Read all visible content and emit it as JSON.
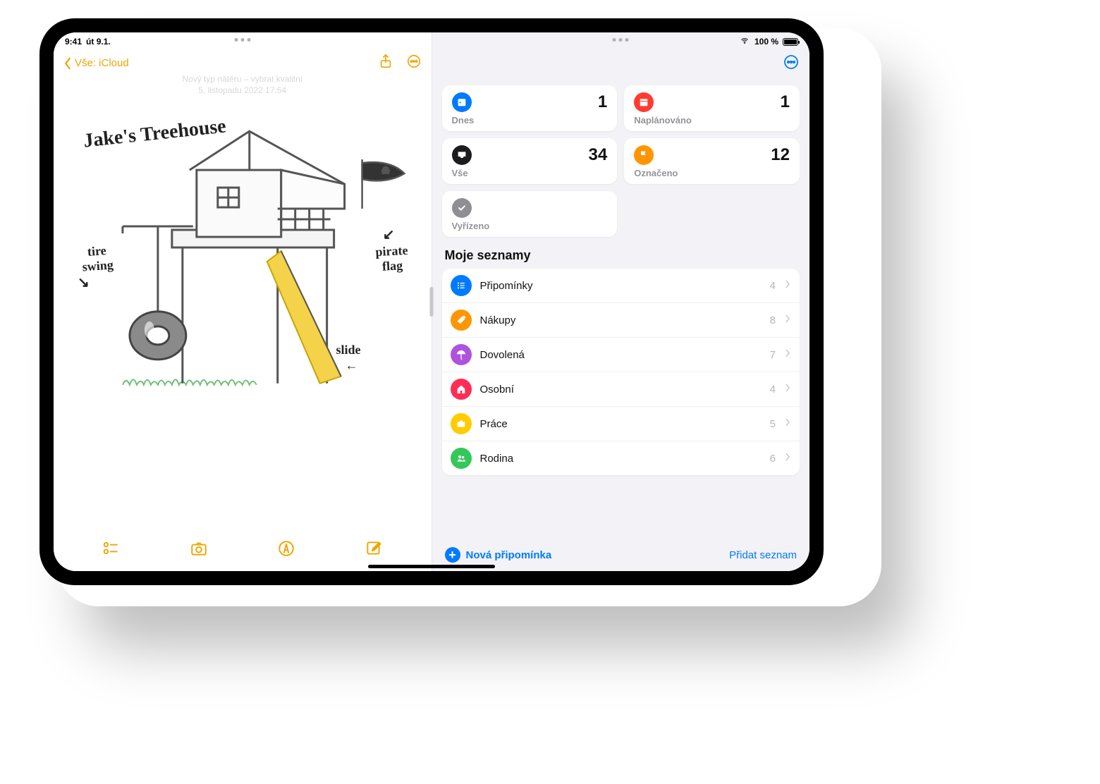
{
  "status": {
    "time": "9:41",
    "date": "út 9.1.",
    "battery_text": "100 %"
  },
  "notes": {
    "back_label": "Vše: iCloud",
    "meta_line1": "Nový typ nátěru – vybrat kvalitní",
    "meta_line2": "5. listopadu 2022 17:54",
    "sketch_title": "Jake's Treehouse",
    "ann_tire_swing": "tire swing",
    "ann_pirate_flag": "pirate flag",
    "ann_slide": "slide"
  },
  "reminders": {
    "cards": {
      "today": {
        "label": "Dnes",
        "count": "1",
        "color": "#007aff"
      },
      "scheduled": {
        "label": "Naplánováno",
        "count": "1",
        "color": "#ff3b30"
      },
      "all": {
        "label": "Vše",
        "count": "34",
        "color": "#1c1c1e"
      },
      "flagged": {
        "label": "Označeno",
        "count": "12",
        "color": "#ff9500"
      },
      "completed": {
        "label": "Vyřízeno",
        "count": "",
        "color": "#8e8e93"
      }
    },
    "lists_title": "Moje seznamy",
    "lists": [
      {
        "name": "Připomínky",
        "count": "4",
        "color": "#007aff",
        "icon": "list"
      },
      {
        "name": "Nákupy",
        "count": "8",
        "color": "#ff9500",
        "icon": "carrot"
      },
      {
        "name": "Dovolená",
        "count": "7",
        "color": "#af52de",
        "icon": "umbrella"
      },
      {
        "name": "Osobní",
        "count": "4",
        "color": "#ff2d55",
        "icon": "home"
      },
      {
        "name": "Práce",
        "count": "5",
        "color": "#ffcc00",
        "icon": "briefcase"
      },
      {
        "name": "Rodina",
        "count": "6",
        "color": "#34c759",
        "icon": "people"
      }
    ],
    "new_reminder": "Nová připomínka",
    "add_list": "Přidat seznam"
  }
}
